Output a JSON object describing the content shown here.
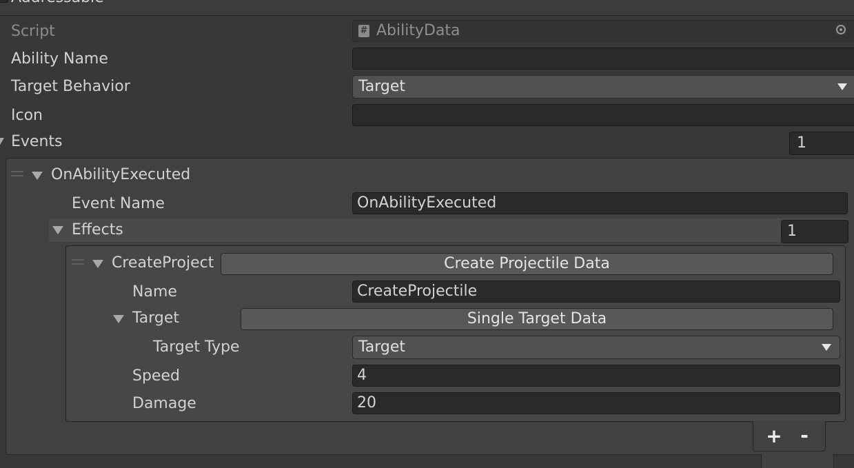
{
  "header": {
    "title": "Addressable"
  },
  "fields": {
    "script_label": "Script",
    "script_value": "AbilityData",
    "ability_name_label": "Ability Name",
    "ability_name_value": "",
    "target_behavior_label": "Target Behavior",
    "target_behavior_value": "Target",
    "icon_label": "Icon",
    "icon_value": ""
  },
  "events": {
    "label": "Events",
    "count": "1",
    "item": {
      "title": "OnAbilityExecuted",
      "event_name_label": "Event Name",
      "event_name_value": "OnAbilityExecuted",
      "effects": {
        "label": "Effects",
        "count": "1",
        "item": {
          "title": "CreateProject",
          "type_button": "Create Projectile Data",
          "name_label": "Name",
          "name_value": "CreateProjectile",
          "target_label": "Target",
          "target_button": "Single Target Data",
          "target_type_label": "Target Type",
          "target_type_value": "Target",
          "speed_label": "Speed",
          "speed_value": "4",
          "damage_label": "Damage",
          "damage_value": "20"
        }
      },
      "add_button": "+",
      "remove_button": "-"
    }
  },
  "icons": [
    "script-hash-icon",
    "object-picker-icon",
    "dropdown-arrow-icon",
    "foldout-arrow-icon",
    "drag-handle-icon"
  ]
}
